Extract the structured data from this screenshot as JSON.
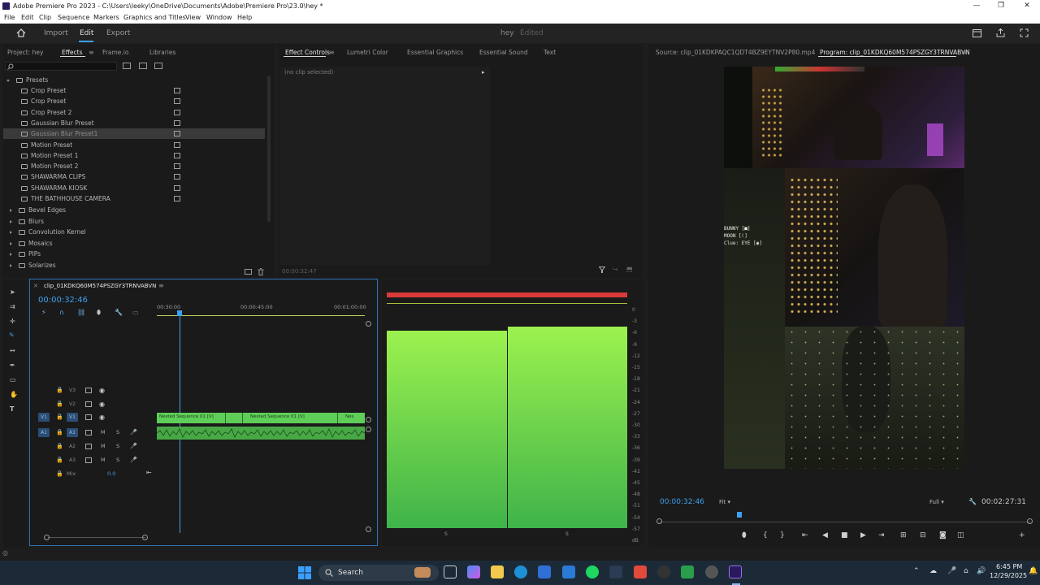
{
  "window": {
    "title": "Adobe Premiere Pro 2023 - C:\\Users\\leeky\\OneDrive\\Documents\\Adobe\\Premiere Pro\\23.0\\hey *",
    "controls": [
      "—",
      "❐",
      "✕"
    ]
  },
  "menu": [
    "File",
    "Edit",
    "Clip",
    "Sequence",
    "Markers",
    "Graphics and Titles",
    "View",
    "Window",
    "Help"
  ],
  "workspace": {
    "tabs": [
      "Import",
      "Edit",
      "Export"
    ],
    "active": "Edit",
    "project_name": "hey",
    "project_status": "Edited"
  },
  "effects_panel": {
    "tabs": [
      "Project: hey",
      "Effects",
      "Frame.io",
      "Libraries"
    ],
    "active_tab": "Effects",
    "search_placeholder": "",
    "presets_label": "Presets",
    "presets": [
      "Crop Preset",
      "Crop Preset",
      "Crop Preset 2",
      "Gaussian Blur Preset",
      "Gaussian Blur Preset1",
      "Motion Preset",
      "Motion Preset 1",
      "Motion Preset 2",
      "SHAWARMA CLIPS",
      "SHAWARMA KIOSK",
      "THE BATHHOUSE CAMERA"
    ],
    "selected_preset": "Gaussian Blur Preset1",
    "categories": [
      "Bevel Edges",
      "Blurs",
      "Convolution Kernel",
      "Mosaics",
      "PIPs",
      "Solarizes"
    ]
  },
  "effect_controls": {
    "tabs": [
      "Effect Controls",
      "Lumetri Color",
      "Essential Graphics",
      "Essential Sound",
      "Text"
    ],
    "active_tab": "Effect Controls",
    "no_clip": "(no clip selected)",
    "timecode": "00:00:32:47"
  },
  "source_monitor": {
    "source_tab": "Source: clip_01KDKPAQC1QDT4BZ9EYTNV2P80.mp4",
    "program_tab": "Program: clip_01KDKQ60M574PSZGY3TRNVABVN",
    "overlay_text": [
      "BUNNY [■]",
      "MOON [☾]",
      "Clue: EYE [◉]"
    ],
    "timecode_left": "00:00:32:46",
    "fit": "Fit",
    "quality": "Full",
    "timecode_right": "00:02:27:31"
  },
  "timeline": {
    "sequence_tab": "clip_01KDKQ60M574PSZGY3TRNVABVN",
    "timecode": "00:00:32:46",
    "ruler": [
      "00:30:00",
      "00:00:45:00",
      "00:01:00:00"
    ],
    "tracks": [
      "V3",
      "V2",
      "V1",
      "A1",
      "A2",
      "A3"
    ],
    "mix_label": "Mix",
    "mix_value": "0.0",
    "clips": [
      "Nested Sequence 01 [V]",
      "Nested Sequence 01 [V]",
      "Nes"
    ],
    "mute_label": "M",
    "solo_label": "S"
  },
  "audio_meter": {
    "scale": [
      "0",
      "-3",
      "-6",
      "-9",
      "-12",
      "-15",
      "-18",
      "-21",
      "-24",
      "-27",
      "-30",
      "-33",
      "-36",
      "-39",
      "-42",
      "-45",
      "-48",
      "-51",
      "-54",
      "-57",
      "dB"
    ],
    "channel_labels": [
      "S",
      "S"
    ],
    "level_left": 0.88,
    "level_right": 0.9
  },
  "taskbar": {
    "search_label": "Search",
    "time": "6:45 PM",
    "date": "12/29/2025"
  },
  "colors": {
    "accent_blue": "#3ea0f0",
    "clip_green": "#5fce58",
    "meter_green_top": "#9cf24e",
    "meter_green_bottom": "#3fb34a",
    "meter_peak_red": "#d93a3a"
  }
}
